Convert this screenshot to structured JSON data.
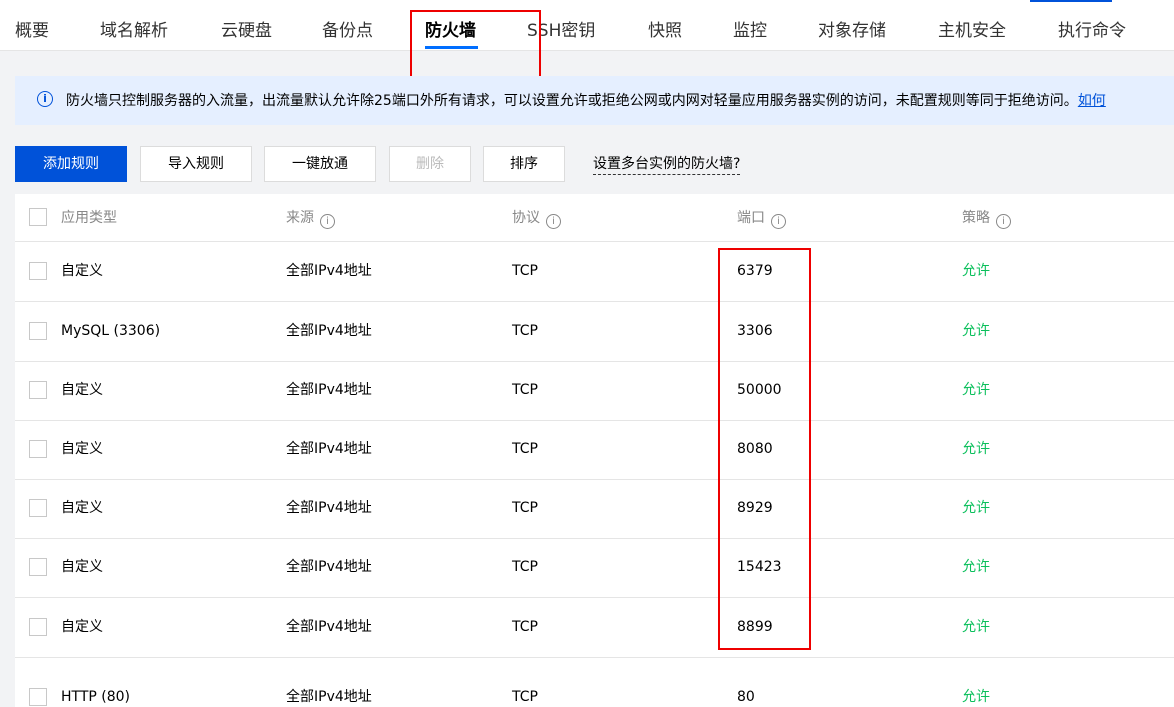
{
  "tabs": [
    {
      "label": "概要"
    },
    {
      "label": "域名解析"
    },
    {
      "label": "云硬盘"
    },
    {
      "label": "备份点"
    },
    {
      "label": "防火墙",
      "active": true
    },
    {
      "label": "SSH密钥"
    },
    {
      "label": "快照"
    },
    {
      "label": "监控"
    },
    {
      "label": "对象存储"
    },
    {
      "label": "主机安全"
    },
    {
      "label": "执行命令"
    }
  ],
  "notice": {
    "text": "防火墙只控制服务器的入流量，出流量默认允许除25端口外所有请求，可以设置允许或拒绝公网或内网对轻量应用服务器实例的访问，未配置规则等同于拒绝访问。",
    "link": "如何"
  },
  "toolbar": {
    "add": "添加规则",
    "import": "导入规则",
    "one_click": "一键放通",
    "delete": "删除",
    "sort": "排序",
    "multi_instance": "设置多台实例的防火墙?"
  },
  "table": {
    "headers": {
      "app_type": "应用类型",
      "source": "来源",
      "protocol": "协议",
      "port": "端口",
      "policy": "策略"
    },
    "rows": [
      {
        "app_type": "自定义",
        "source": "全部IPv4地址",
        "protocol": "TCP",
        "port": "6379",
        "policy": "允许"
      },
      {
        "app_type": "MySQL (3306)",
        "source": "全部IPv4地址",
        "protocol": "TCP",
        "port": "3306",
        "policy": "允许"
      },
      {
        "app_type": "自定义",
        "source": "全部IPv4地址",
        "protocol": "TCP",
        "port": "50000",
        "policy": "允许"
      },
      {
        "app_type": "自定义",
        "source": "全部IPv4地址",
        "protocol": "TCP",
        "port": "8080",
        "policy": "允许"
      },
      {
        "app_type": "自定义",
        "source": "全部IPv4地址",
        "protocol": "TCP",
        "port": "8929",
        "policy": "允许"
      },
      {
        "app_type": "自定义",
        "source": "全部IPv4地址",
        "protocol": "TCP",
        "port": "15423",
        "policy": "允许"
      },
      {
        "app_type": "自定义",
        "source": "全部IPv4地址",
        "protocol": "TCP",
        "port": "8899",
        "policy": "允许"
      },
      {
        "app_type": "HTTP (80)",
        "source": "全部IPv4地址",
        "protocol": "TCP",
        "port": "80",
        "policy": "允许"
      }
    ]
  },
  "colors": {
    "primary": "#0052d9",
    "allow": "#0abf5b",
    "annotation": "#e00000",
    "notice_bg": "#e5efff"
  }
}
